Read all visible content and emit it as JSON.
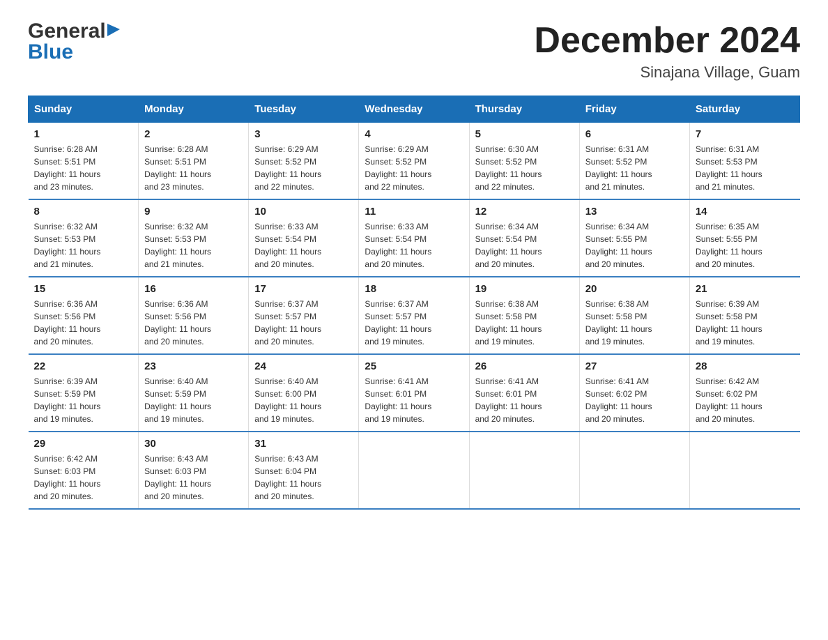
{
  "logo": {
    "text_general": "General",
    "text_blue": "Blue"
  },
  "title": {
    "month_year": "December 2024",
    "location": "Sinajana Village, Guam"
  },
  "headers": [
    "Sunday",
    "Monday",
    "Tuesday",
    "Wednesday",
    "Thursday",
    "Friday",
    "Saturday"
  ],
  "weeks": [
    [
      {
        "day": "1",
        "sunrise": "6:28 AM",
        "sunset": "5:51 PM",
        "daylight": "11 hours and 23 minutes."
      },
      {
        "day": "2",
        "sunrise": "6:28 AM",
        "sunset": "5:51 PM",
        "daylight": "11 hours and 23 minutes."
      },
      {
        "day": "3",
        "sunrise": "6:29 AM",
        "sunset": "5:52 PM",
        "daylight": "11 hours and 22 minutes."
      },
      {
        "day": "4",
        "sunrise": "6:29 AM",
        "sunset": "5:52 PM",
        "daylight": "11 hours and 22 minutes."
      },
      {
        "day": "5",
        "sunrise": "6:30 AM",
        "sunset": "5:52 PM",
        "daylight": "11 hours and 22 minutes."
      },
      {
        "day": "6",
        "sunrise": "6:31 AM",
        "sunset": "5:52 PM",
        "daylight": "11 hours and 21 minutes."
      },
      {
        "day": "7",
        "sunrise": "6:31 AM",
        "sunset": "5:53 PM",
        "daylight": "11 hours and 21 minutes."
      }
    ],
    [
      {
        "day": "8",
        "sunrise": "6:32 AM",
        "sunset": "5:53 PM",
        "daylight": "11 hours and 21 minutes."
      },
      {
        "day": "9",
        "sunrise": "6:32 AM",
        "sunset": "5:53 PM",
        "daylight": "11 hours and 21 minutes."
      },
      {
        "day": "10",
        "sunrise": "6:33 AM",
        "sunset": "5:54 PM",
        "daylight": "11 hours and 20 minutes."
      },
      {
        "day": "11",
        "sunrise": "6:33 AM",
        "sunset": "5:54 PM",
        "daylight": "11 hours and 20 minutes."
      },
      {
        "day": "12",
        "sunrise": "6:34 AM",
        "sunset": "5:54 PM",
        "daylight": "11 hours and 20 minutes."
      },
      {
        "day": "13",
        "sunrise": "6:34 AM",
        "sunset": "5:55 PM",
        "daylight": "11 hours and 20 minutes."
      },
      {
        "day": "14",
        "sunrise": "6:35 AM",
        "sunset": "5:55 PM",
        "daylight": "11 hours and 20 minutes."
      }
    ],
    [
      {
        "day": "15",
        "sunrise": "6:36 AM",
        "sunset": "5:56 PM",
        "daylight": "11 hours and 20 minutes."
      },
      {
        "day": "16",
        "sunrise": "6:36 AM",
        "sunset": "5:56 PM",
        "daylight": "11 hours and 20 minutes."
      },
      {
        "day": "17",
        "sunrise": "6:37 AM",
        "sunset": "5:57 PM",
        "daylight": "11 hours and 20 minutes."
      },
      {
        "day": "18",
        "sunrise": "6:37 AM",
        "sunset": "5:57 PM",
        "daylight": "11 hours and 19 minutes."
      },
      {
        "day": "19",
        "sunrise": "6:38 AM",
        "sunset": "5:58 PM",
        "daylight": "11 hours and 19 minutes."
      },
      {
        "day": "20",
        "sunrise": "6:38 AM",
        "sunset": "5:58 PM",
        "daylight": "11 hours and 19 minutes."
      },
      {
        "day": "21",
        "sunrise": "6:39 AM",
        "sunset": "5:58 PM",
        "daylight": "11 hours and 19 minutes."
      }
    ],
    [
      {
        "day": "22",
        "sunrise": "6:39 AM",
        "sunset": "5:59 PM",
        "daylight": "11 hours and 19 minutes."
      },
      {
        "day": "23",
        "sunrise": "6:40 AM",
        "sunset": "5:59 PM",
        "daylight": "11 hours and 19 minutes."
      },
      {
        "day": "24",
        "sunrise": "6:40 AM",
        "sunset": "6:00 PM",
        "daylight": "11 hours and 19 minutes."
      },
      {
        "day": "25",
        "sunrise": "6:41 AM",
        "sunset": "6:01 PM",
        "daylight": "11 hours and 19 minutes."
      },
      {
        "day": "26",
        "sunrise": "6:41 AM",
        "sunset": "6:01 PM",
        "daylight": "11 hours and 20 minutes."
      },
      {
        "day": "27",
        "sunrise": "6:41 AM",
        "sunset": "6:02 PM",
        "daylight": "11 hours and 20 minutes."
      },
      {
        "day": "28",
        "sunrise": "6:42 AM",
        "sunset": "6:02 PM",
        "daylight": "11 hours and 20 minutes."
      }
    ],
    [
      {
        "day": "29",
        "sunrise": "6:42 AM",
        "sunset": "6:03 PM",
        "daylight": "11 hours and 20 minutes."
      },
      {
        "day": "30",
        "sunrise": "6:43 AM",
        "sunset": "6:03 PM",
        "daylight": "11 hours and 20 minutes."
      },
      {
        "day": "31",
        "sunrise": "6:43 AM",
        "sunset": "6:04 PM",
        "daylight": "11 hours and 20 minutes."
      },
      null,
      null,
      null,
      null
    ]
  ],
  "labels": {
    "sunrise": "Sunrise:",
    "sunset": "Sunset:",
    "daylight": "Daylight:"
  }
}
